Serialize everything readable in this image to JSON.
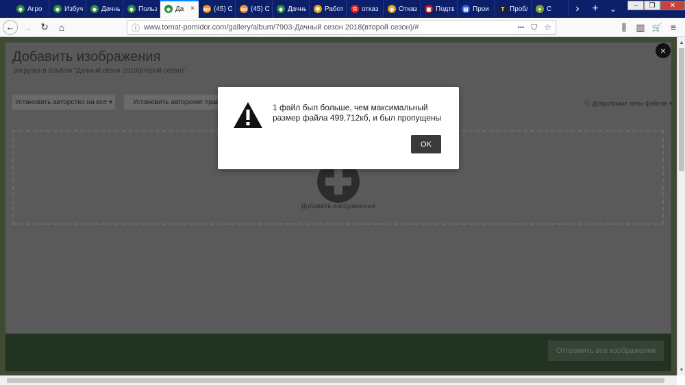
{
  "browser": {
    "tabs": [
      {
        "label": "Агро",
        "icon_color": "#2e8b3a",
        "icon_glyph": "◆"
      },
      {
        "label": "Избуч",
        "icon_color": "#2e8b3a",
        "icon_glyph": "◆"
      },
      {
        "label": "Дачны",
        "icon_color": "#2e8b3a",
        "icon_glyph": "◆"
      },
      {
        "label": "Польз",
        "icon_color": "#2e8b3a",
        "icon_glyph": "◆"
      },
      {
        "label": "Да",
        "icon_color": "#2e8b3a",
        "icon_glyph": "◆",
        "active": true,
        "close_glyph": "×"
      },
      {
        "label": "(45) О",
        "icon_color": "#f08a24",
        "icon_glyph": "ок"
      },
      {
        "label": "(45) О",
        "icon_color": "#f08a24",
        "icon_glyph": "ок"
      },
      {
        "label": "Дачны",
        "icon_color": "#2e8b3a",
        "icon_glyph": "◆"
      },
      {
        "label": "Работ",
        "icon_color": "#d9a419",
        "icon_glyph": "✱"
      },
      {
        "label": "отказ",
        "icon_color": "#e02020",
        "icon_glyph": "Я"
      },
      {
        "label": "Отказ",
        "icon_color": "#e0a020",
        "icon_glyph": "◈"
      },
      {
        "label": "Подтв",
        "icon_color": "#c01010",
        "icon_glyph": "▣"
      },
      {
        "label": "Прои",
        "icon_color": "#3060d0",
        "icon_glyph": "▤"
      },
      {
        "label": "Пробл",
        "icon_color": "#222222",
        "icon_glyph": "Т"
      },
      {
        "label": "С",
        "icon_color": "#7aa030",
        "icon_glyph": "●"
      }
    ],
    "tab_scroll_glyph": "›",
    "new_tab_glyph": "+",
    "tabs_menu_glyph": "⌄",
    "window_controls": {
      "minimize": "–",
      "restore": "❐",
      "close": "✕"
    },
    "nav": {
      "back_glyph": "←",
      "forward_glyph": "→",
      "reload_glyph": "↻",
      "home_glyph": "⌂"
    },
    "url": "www.tomat-pomidor.com/gallery/album/7903-Дачный сезон 2018(второй сезон)/#",
    "url_info_glyph": "ⓘ",
    "url_actions": {
      "more": "•••",
      "pocket": "⛉",
      "star": "☆"
    },
    "toolbar": {
      "library": "⫼",
      "sidebar": "▥",
      "cart": "🛒",
      "menu": "≡"
    }
  },
  "modal": {
    "title": "Добавить изображения",
    "subtitle": "Загрузка в альбом \"Дачный сезон 2018(второй сезон)\"",
    "close_glyph": "×",
    "set_author_label": "Установить авторство на все ▾",
    "set_rights_label": "Установить авторские права н",
    "file_types_label": "ⓘ Допустимые типы файлов ▾",
    "dropzone_label": "Добавить изображения",
    "submit_label": "Отправить все изображения"
  },
  "alert": {
    "message": "1 файл был больше, чем максимальный размер файла 499,712кб, и был пропущены",
    "ok_label": "OK"
  },
  "scrollbar": {
    "up_glyph": "▲",
    "down_glyph": "▼"
  },
  "colors": {
    "tab_strip": "#0b1f6b",
    "accent": "#0a84ff",
    "overlay_bg": "#3f4a35",
    "modal_footer": "#223322"
  }
}
